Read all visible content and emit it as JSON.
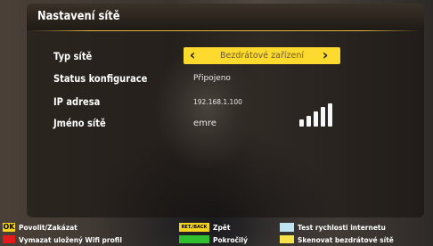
{
  "window": {
    "title": "Nastavení sítě"
  },
  "settings": {
    "network_type": {
      "label": "Typ sítě",
      "value": "Bezdrátové zařízení"
    },
    "config_status": {
      "label": "Status konfigurace",
      "value": "Připojeno"
    },
    "ip_address": {
      "label": "IP adresa",
      "value": "192.168.1.100"
    },
    "network_name": {
      "label": "Jméno sítě",
      "value": "emre",
      "signal_bars": 5,
      "signal_bars_filled": 5
    }
  },
  "legend": {
    "ok_key": "OK",
    "ok_label": "Povolit/Zakázat",
    "back_key": "RET./BACK",
    "back_label": "Zpět",
    "blue_label": "Test rychlosti internetu",
    "red_label": "Vymazat uložený Wifi profil",
    "green_label": "Pokročilý",
    "yellow_label": "Skenovat bezdrátové sítě"
  },
  "colors": {
    "selector": "#fddb2e",
    "red": "#e21a1a",
    "green": "#2fbf2f",
    "blue": "#bfe3f3",
    "yellow": "#f6e24a"
  }
}
